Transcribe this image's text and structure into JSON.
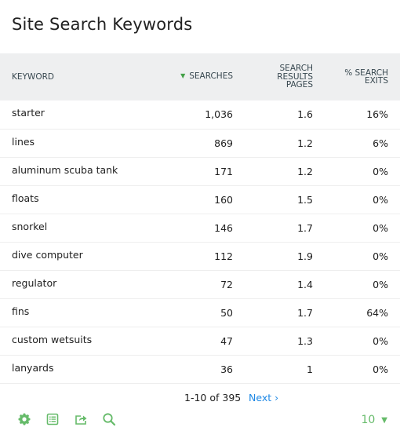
{
  "widget": {
    "title": "Site Search Keywords"
  },
  "table": {
    "columns": [
      {
        "key": "keyword",
        "label": "Keyword",
        "sorted": false
      },
      {
        "key": "searches",
        "label": "Searches",
        "sorted": true,
        "sort_direction": "descending"
      },
      {
        "key": "results_pages",
        "label_lines": [
          "Search",
          "Results",
          "Pages"
        ]
      },
      {
        "key": "exits",
        "label_lines": [
          "% Search",
          "Exits"
        ]
      }
    ],
    "rows": [
      {
        "keyword": "starter",
        "searches": "1,036",
        "results_pages": "1.6",
        "exits": "16%"
      },
      {
        "keyword": "lines",
        "searches": "869",
        "results_pages": "1.2",
        "exits": "6%"
      },
      {
        "keyword": "aluminum scuba tank",
        "searches": "171",
        "results_pages": "1.2",
        "exits": "0%"
      },
      {
        "keyword": "floats",
        "searches": "160",
        "results_pages": "1.5",
        "exits": "0%"
      },
      {
        "keyword": "snorkel",
        "searches": "146",
        "results_pages": "1.7",
        "exits": "0%"
      },
      {
        "keyword": "dive computer",
        "searches": "112",
        "results_pages": "1.9",
        "exits": "0%"
      },
      {
        "keyword": "regulator",
        "searches": "72",
        "results_pages": "1.4",
        "exits": "0%"
      },
      {
        "keyword": "fins",
        "searches": "50",
        "results_pages": "1.7",
        "exits": "64%"
      },
      {
        "keyword": "custom wetsuits",
        "searches": "47",
        "results_pages": "1.3",
        "exits": "0%"
      },
      {
        "keyword": "lanyards",
        "searches": "36",
        "results_pages": "1",
        "exits": "0%"
      }
    ]
  },
  "pagination": {
    "range_text": "1-10 of 395",
    "next_label": "Next ›"
  },
  "footer": {
    "icons": [
      "gear-icon",
      "table-view-icon",
      "export-icon",
      "search-icon"
    ],
    "limit_value": "10",
    "limit_arrow": "▼"
  },
  "colors": {
    "accent_green": "#66bb6a",
    "sort_arrow_green": "#43a047",
    "link_blue": "#1e88e5",
    "header_bg": "#eeeff0"
  }
}
